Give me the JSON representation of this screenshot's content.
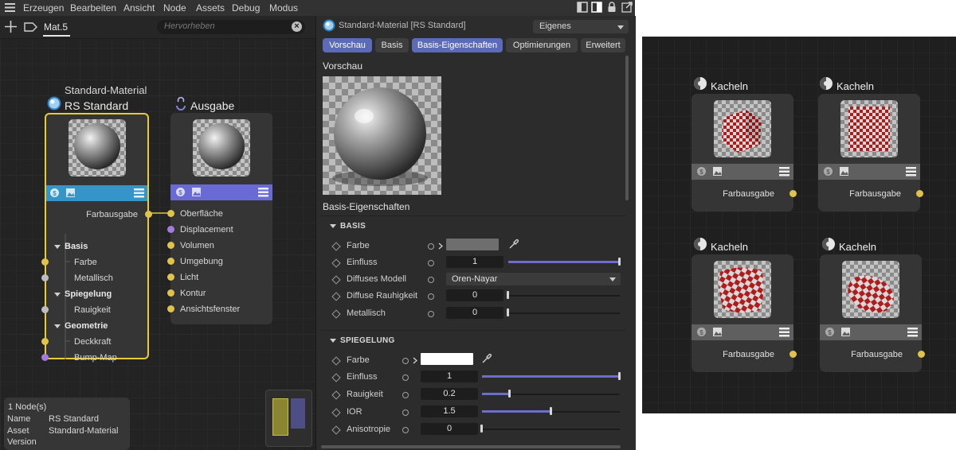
{
  "menu": [
    "Erzeugen",
    "Bearbeiten",
    "Ansicht",
    "Node",
    "Assets",
    "Debug",
    "Modus"
  ],
  "editor": {
    "tab_label": "Mat.5",
    "highlight_placeholder": "Hervorheben"
  },
  "nodes": {
    "standard": {
      "subtitle": "Standard-Material",
      "title": "RS Standard",
      "out_port": "Farbausgabe",
      "groups": [
        {
          "label": "Basis",
          "ports": [
            "Farbe",
            "Metallisch"
          ]
        },
        {
          "label": "Spiegelung",
          "ports": [
            "Rauigkeit"
          ]
        },
        {
          "label": "Geometrie",
          "ports": [
            "Deckkraft",
            "Bump-Map"
          ]
        }
      ]
    },
    "ausgabe": {
      "title": "Ausgabe",
      "ports": [
        "Oberfläche",
        "Displacement",
        "Volumen",
        "Umgebung",
        "Licht",
        "Kontur",
        "Ansichtsfenster"
      ]
    }
  },
  "info": {
    "count": "1 Node(s)",
    "rows": [
      {
        "key": "Name",
        "value": "RS Standard"
      },
      {
        "key": "Asset",
        "value": "Standard-Material"
      },
      {
        "key": "Version",
        "value": ""
      }
    ]
  },
  "attributes": {
    "header_title": "Standard-Material [RS Standard]",
    "mode": "Eigenes",
    "tabs": [
      {
        "label": "Vorschau",
        "active": true
      },
      {
        "label": "Basis",
        "active": false
      },
      {
        "label": "Basis-Eigenschaften",
        "active": true
      },
      {
        "label": "Optimierungen",
        "active": false
      },
      {
        "label": "Erweitert",
        "active": false
      }
    ],
    "preview_label": "Vorschau",
    "props_label": "Basis-Eigenschaften",
    "basis": {
      "section": "BASIS",
      "farbe_label": "Farbe",
      "farbe_color": "#6e6e6e",
      "einfluss_label": "Einfluss",
      "einfluss_value": "1",
      "einfluss_level": 1.0,
      "diffuses_label": "Diffuses Modell",
      "diffuses_value": "Oren-Nayar",
      "rauhigkeit_label": "Diffuse Rauhigkeit",
      "rauhigkeit_value": "0",
      "rauhigkeit_level": 0.0,
      "metallisch_label": "Metallisch",
      "metallisch_value": "0",
      "metallisch_level": 0.0
    },
    "spiegelung": {
      "section": "SPIEGELUNG",
      "farbe_label": "Farbe",
      "farbe_color": "#ffffff",
      "einfluss_label": "Einfluss",
      "einfluss_value": "1",
      "einfluss_level": 1.0,
      "rauigkeit_label": "Rauigkeit",
      "rauigkeit_value": "0.2",
      "rauigkeit_level": 0.2,
      "ior_label": "IOR",
      "ior_value": "1.5",
      "ior_level": 0.5,
      "aniso_label": "Anisotropie",
      "aniso_value": "0",
      "aniso_level": 0.0
    }
  },
  "kacheln": [
    {
      "title": "Kacheln",
      "out": "Farbausgabe"
    },
    {
      "title": "Kacheln",
      "out": "Farbausgabe"
    },
    {
      "title": "Kacheln",
      "out": "Farbausgabe"
    },
    {
      "title": "Kacheln",
      "out": "Farbausgabe"
    }
  ],
  "colors": {
    "selection": "#e7cc36",
    "standard_bar": "#3595c8",
    "ausgabe_bar": "#6a6ad6",
    "tab_active": "#5b6bb8",
    "port_yellow": "#e0c34a",
    "port_purple": "#a47cdb"
  }
}
